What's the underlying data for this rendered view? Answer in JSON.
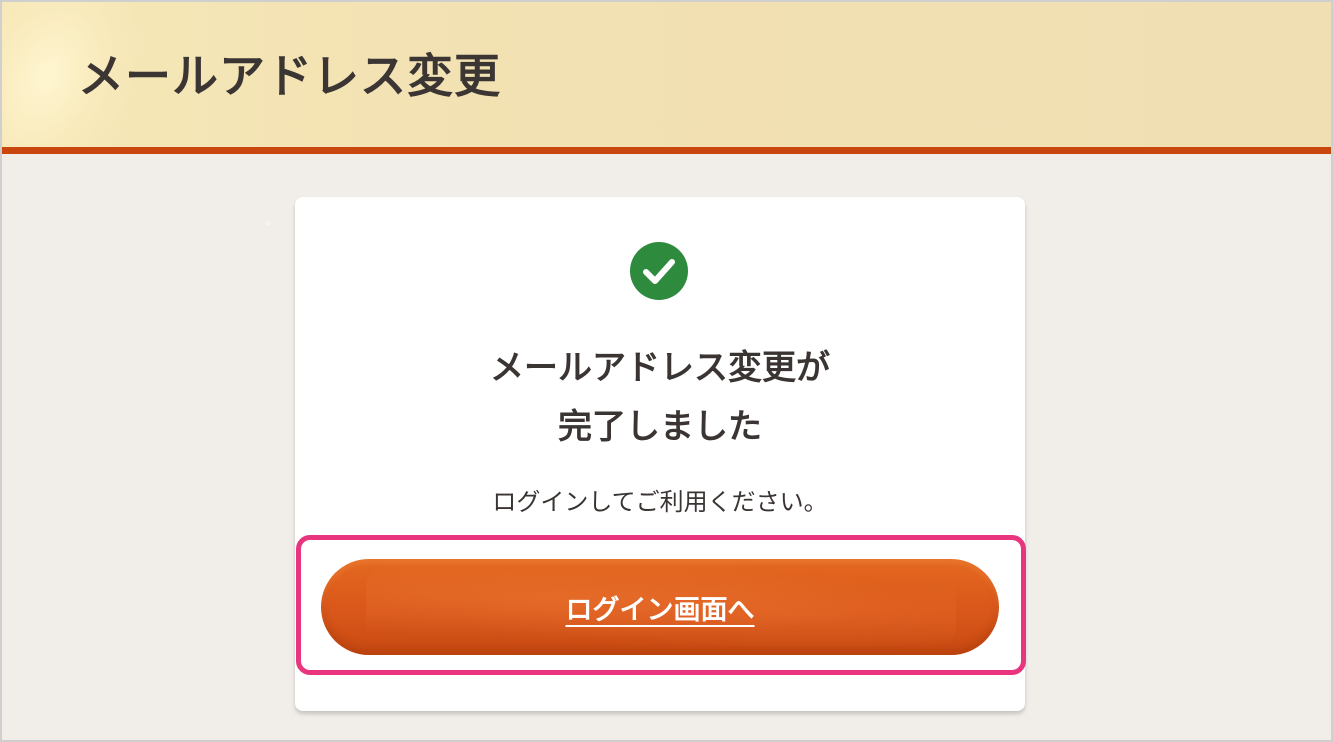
{
  "header": {
    "title": "メールアドレス変更"
  },
  "card": {
    "status_icon": "check-circle-icon",
    "headline_line1": "メールアドレス変更が",
    "headline_line2": "完了しました",
    "message": "ログインしてご利用ください。",
    "login_button_label": "ログイン画面へ"
  },
  "colors": {
    "accent": "#c9470e",
    "button": "#dc5b1b",
    "success": "#2e8b3e",
    "highlight": "#e8357d"
  }
}
